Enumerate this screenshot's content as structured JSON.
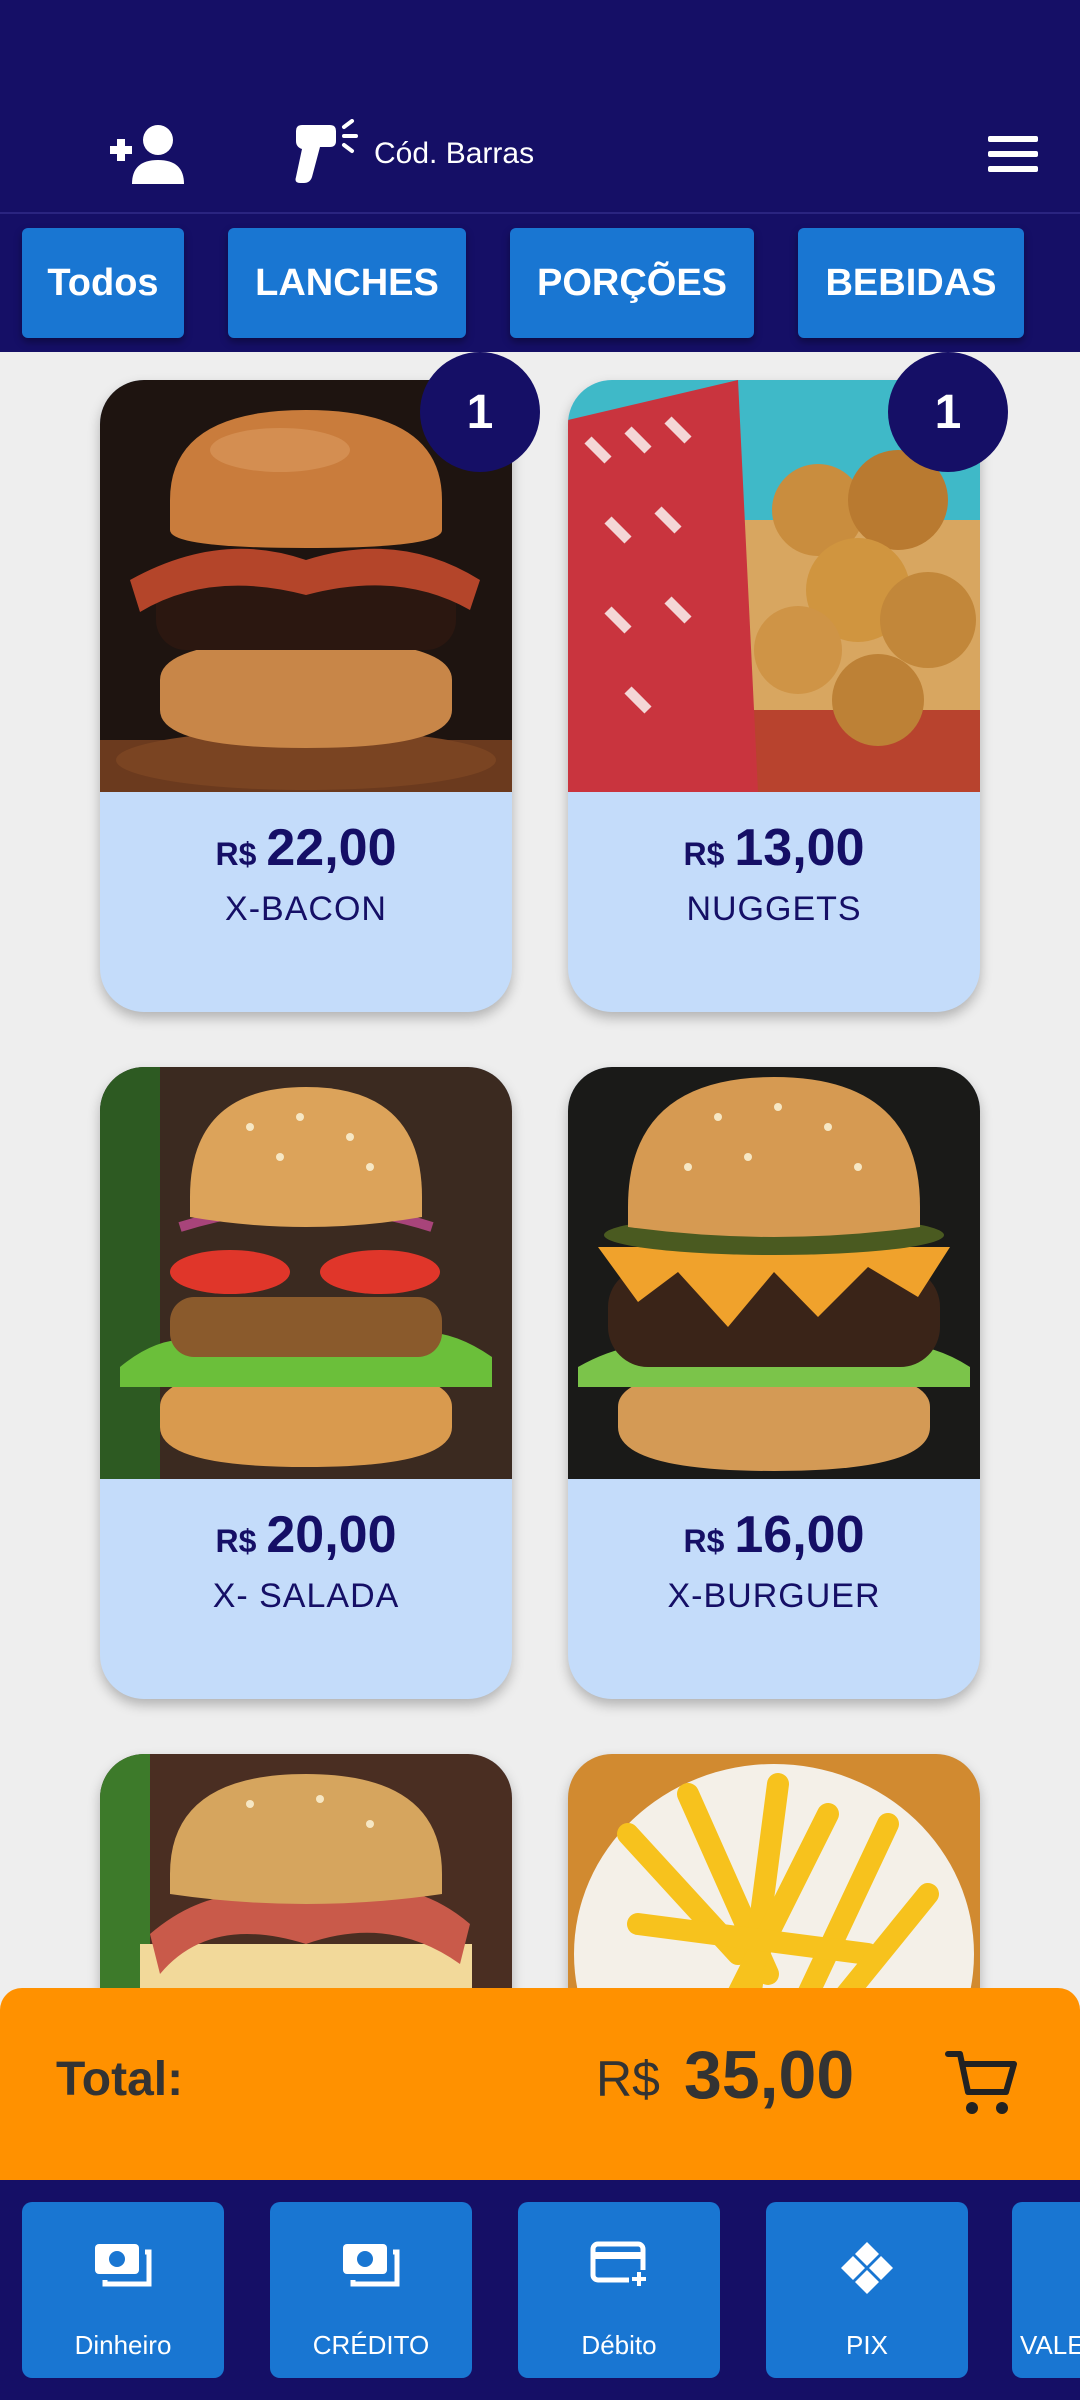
{
  "header": {
    "barcode_label": "Cód. Barras"
  },
  "tabs": [
    {
      "label": "Todos"
    },
    {
      "label": "LANCHES"
    },
    {
      "label": "PORÇÕES"
    },
    {
      "label": "BEBIDAS"
    }
  ],
  "products": [
    {
      "currency": "R$",
      "price": "22,00",
      "name": "X-BACON",
      "qty": "1"
    },
    {
      "currency": "R$",
      "price": "13,00",
      "name": "NUGGETS",
      "qty": "1"
    },
    {
      "currency": "R$",
      "price": "20,00",
      "name": "X- SALADA"
    },
    {
      "currency": "R$",
      "price": "16,00",
      "name": "X-BURGUER"
    }
  ],
  "total": {
    "label": "Total:",
    "currency": "R$",
    "value": "35,00"
  },
  "payments": [
    {
      "label": "Dinheiro",
      "icon": "cash-icon"
    },
    {
      "label": "CRÉDITO",
      "icon": "cash-icon"
    },
    {
      "label": "Débito",
      "icon": "card-add-icon"
    },
    {
      "label": "PIX",
      "icon": "pix-icon"
    },
    {
      "label": "VALE",
      "icon": "voucher-icon"
    }
  ],
  "colors": {
    "header_bg": "#150f66",
    "tab_bg": "#1976d2",
    "card_bg": "#c4dcfa",
    "total_bar": "#ff9100"
  }
}
